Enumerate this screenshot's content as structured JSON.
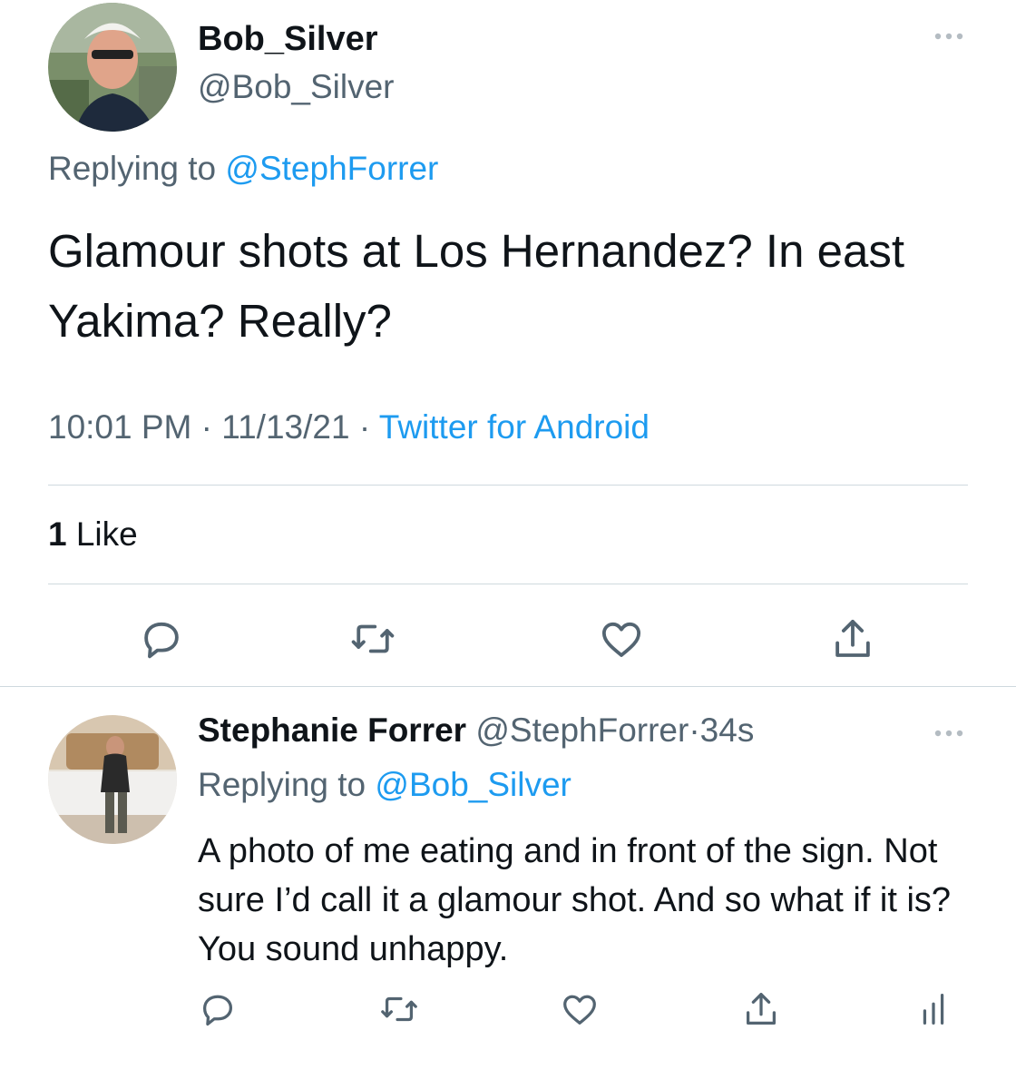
{
  "main_tweet": {
    "display_name": "Bob_Silver",
    "handle": "@Bob_Silver",
    "replying_prefix": "Replying to",
    "replying_handle": "@StephForrer",
    "text": "Glamour shots at Los Hernandez? In east Yakima? Really?",
    "time": "10:01 PM",
    "date": "11/13/21",
    "separator": "·",
    "source": "Twitter for Android",
    "likes_count": "1",
    "likes_label": "Like"
  },
  "reply_tweet": {
    "display_name": "Stephanie Forrer",
    "handle": "@StephForrer",
    "separator": "·",
    "age": "34s",
    "replying_prefix": "Replying to",
    "replying_handle": "@Bob_Silver",
    "text": "A photo of me eating and in front of the sign. Not sure I’d call it a glamour shot. And so what if it is? You sound unhappy."
  },
  "icons": {
    "more": "more-dots-icon",
    "reply": "reply-icon",
    "retweet": "retweet-icon",
    "like": "heart-icon",
    "share": "share-icon",
    "analytics": "analytics-icon"
  },
  "colors": {
    "text": "#0f1419",
    "muted": "#536471",
    "link": "#1d9bf0",
    "divider": "#cfd9de"
  }
}
